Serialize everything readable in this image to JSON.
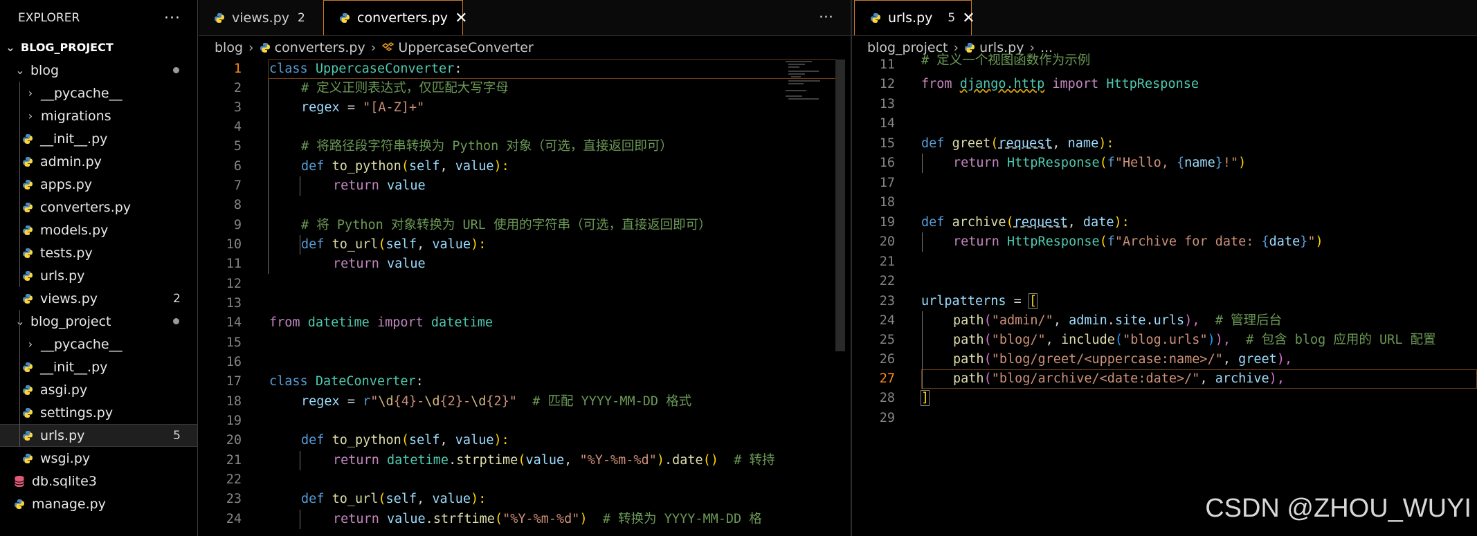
{
  "explorer": {
    "title": "EXPLORER",
    "more": "···",
    "project": "BLOG_PROJECT",
    "items": [
      {
        "label": "blog",
        "kind": "folder"
      },
      {
        "label": "__pycache__",
        "kind": "folder"
      },
      {
        "label": "migrations",
        "kind": "folder"
      },
      {
        "label": "__init__.py",
        "kind": "file"
      },
      {
        "label": "admin.py",
        "kind": "file"
      },
      {
        "label": "apps.py",
        "kind": "file"
      },
      {
        "label": "converters.py",
        "kind": "file"
      },
      {
        "label": "models.py",
        "kind": "file"
      },
      {
        "label": "tests.py",
        "kind": "file"
      },
      {
        "label": "urls.py",
        "kind": "file"
      },
      {
        "label": "views.py",
        "kind": "file",
        "count": "2"
      },
      {
        "label": "blog_project",
        "kind": "folder"
      },
      {
        "label": "__pycache__",
        "kind": "folder"
      },
      {
        "label": "__init__.py",
        "kind": "file"
      },
      {
        "label": "asgi.py",
        "kind": "file"
      },
      {
        "label": "settings.py",
        "kind": "file"
      },
      {
        "label": "urls.py",
        "kind": "file",
        "count": "5"
      },
      {
        "label": "wsgi.py",
        "kind": "file"
      },
      {
        "label": "db.sqlite3",
        "kind": "db"
      },
      {
        "label": "manage.py",
        "kind": "file"
      }
    ]
  },
  "left_tabs": {
    "tab1": {
      "label": "views.py",
      "badge": "2"
    },
    "tab2": {
      "label": "converters.py",
      "close": "✕"
    },
    "more": "···"
  },
  "right_tabs": {
    "tab1": {
      "label": "urls.py",
      "badge": "5",
      "close": "✕"
    }
  },
  "left_breadcrumb": {
    "part1": "blog",
    "part2": "converters.py",
    "part3": "UppercaseConverter"
  },
  "right_breadcrumb": {
    "part1": "blog_project",
    "part2": "urls.py",
    "part3": "..."
  },
  "left_code": {
    "line_numbers": [
      "1",
      "2",
      "3",
      "4",
      "5",
      "6",
      "7",
      "8",
      "9",
      "10",
      "11",
      "12",
      "13",
      "14",
      "15",
      "16",
      "17",
      "18",
      "19",
      "20",
      "21",
      "22",
      "23",
      "24"
    ],
    "l1": {
      "a": "class",
      "b": "UppercaseConverter",
      "c": ":"
    },
    "l2": "# 定义正则表达式，仅匹配大写字母",
    "l3": {
      "a": "regex",
      "b": " = ",
      "c": "\"[A-Z]+\""
    },
    "l5": "# 将路径段字符串转换为 Python 对象（可选，直接返回即可）",
    "l6": {
      "a": "def",
      "b": "to_python",
      "c": "(",
      "d": "self",
      "e": ", ",
      "f": "value",
      "g": "):"
    },
    "l7": {
      "a": "return",
      "b": "value"
    },
    "l9": "# 将 Python 对象转换为 URL 使用的字符串（可选，直接返回即可）",
    "l10": {
      "a": "def",
      "b": "to_url",
      "c": "(",
      "d": "self",
      "e": ", ",
      "f": "value",
      "g": "):"
    },
    "l11": {
      "a": "return",
      "b": "value"
    },
    "l14": {
      "a": "from",
      "b": "datetime",
      "c": "import",
      "d": "datetime"
    },
    "l17": {
      "a": "class",
      "b": "DateConverter",
      "c": ":"
    },
    "l18": {
      "a": "regex",
      "b": " = ",
      "c": "r",
      "d": "\"",
      "e": "\\d",
      "f": "{4}",
      "g": "-",
      "h": "\\d",
      "i": "{2}",
      "j": "-",
      "k": "\\d",
      "l": "{2}",
      "m": "\"",
      "n": "# 匹配 YYYY-MM-DD 格式"
    },
    "l20": {
      "a": "def",
      "b": "to_python",
      "c": "(",
      "d": "self",
      "e": ", ",
      "f": "value",
      "g": "):"
    },
    "l21": {
      "a": "return",
      "b": "datetime",
      "c": ".",
      "d": "strptime",
      "e": "(",
      "f": "value",
      "g": ", ",
      "h": "\"%Y-%m-%d\"",
      "i": ")",
      "j": ".",
      "k": "date",
      "l": "()",
      "m": "# 转持"
    },
    "l23": {
      "a": "def",
      "b": "to_url",
      "c": "(",
      "d": "self",
      "e": ", ",
      "f": "value",
      "g": "):"
    },
    "l24": {
      "a": "return",
      "b": "value",
      "c": ".",
      "d": "strftime",
      "e": "(",
      "f": "\"%Y-%m-%d\"",
      "g": ")",
      "h": "# 转换为 YYYY-MM-DD 格"
    }
  },
  "right_code": {
    "line_numbers": [
      "11",
      "12",
      "13",
      "14",
      "15",
      "16",
      "17",
      "18",
      "19",
      "20",
      "21",
      "22",
      "23",
      "24",
      "25",
      "26",
      "27",
      "28",
      "29"
    ],
    "l11": "# 定义一个视图函数作为示例",
    "l12": {
      "a": "from",
      "b": "django.http",
      "c": "import",
      "d": "HttpResponse"
    },
    "l15": {
      "a": "def",
      "b": "greet",
      "c": "(",
      "d": "request",
      "e": ", ",
      "f": "name",
      "g": "):"
    },
    "l16": {
      "a": "return",
      "b": "HttpResponse",
      "c": "(",
      "d": "f",
      "e": "\"Hello, ",
      "f": "{",
      "g": "name",
      "h": "}",
      "i": "!\"",
      "j": ")"
    },
    "l19": {
      "a": "def",
      "b": "archive",
      "c": "(",
      "d": "request",
      "e": ", ",
      "f": "date",
      "g": "):"
    },
    "l20": {
      "a": "return",
      "b": "HttpResponse",
      "c": "(",
      "d": "f",
      "e": "\"Archive for date: ",
      "f": "{",
      "g": "date",
      "h": "}",
      "i": "\"",
      "j": ")"
    },
    "l23": {
      "a": "urlpatterns",
      "b": " = ",
      "c": "["
    },
    "l24": {
      "a": "path",
      "b": "(",
      "c": "\"admin/\"",
      "d": ", ",
      "e": "admin",
      "f": ".",
      "g": "site",
      "h": ".",
      "i": "urls",
      "j": "),",
      "k": "# 管理后台"
    },
    "l25": {
      "a": "path",
      "b": "(",
      "c": "\"blog/\"",
      "d": ", ",
      "e": "include",
      "f": "(",
      "g": "\"blog.urls\"",
      "h": ")",
      "i": "),",
      "j": "# 包含 blog 应用的 URL 配置"
    },
    "l26": {
      "a": "path",
      "b": "(",
      "c": "\"blog/greet/<uppercase:name>/\"",
      "d": ", ",
      "e": "greet",
      "f": "),"
    },
    "l27": {
      "a": "path",
      "b": "(",
      "c": "\"blog/archive/<date:date>/\"",
      "d": ", ",
      "e": "archive",
      "f": "),"
    },
    "l28": {
      "a": "]"
    }
  },
  "watermark": "CSDN @ZHOU_WUYI"
}
